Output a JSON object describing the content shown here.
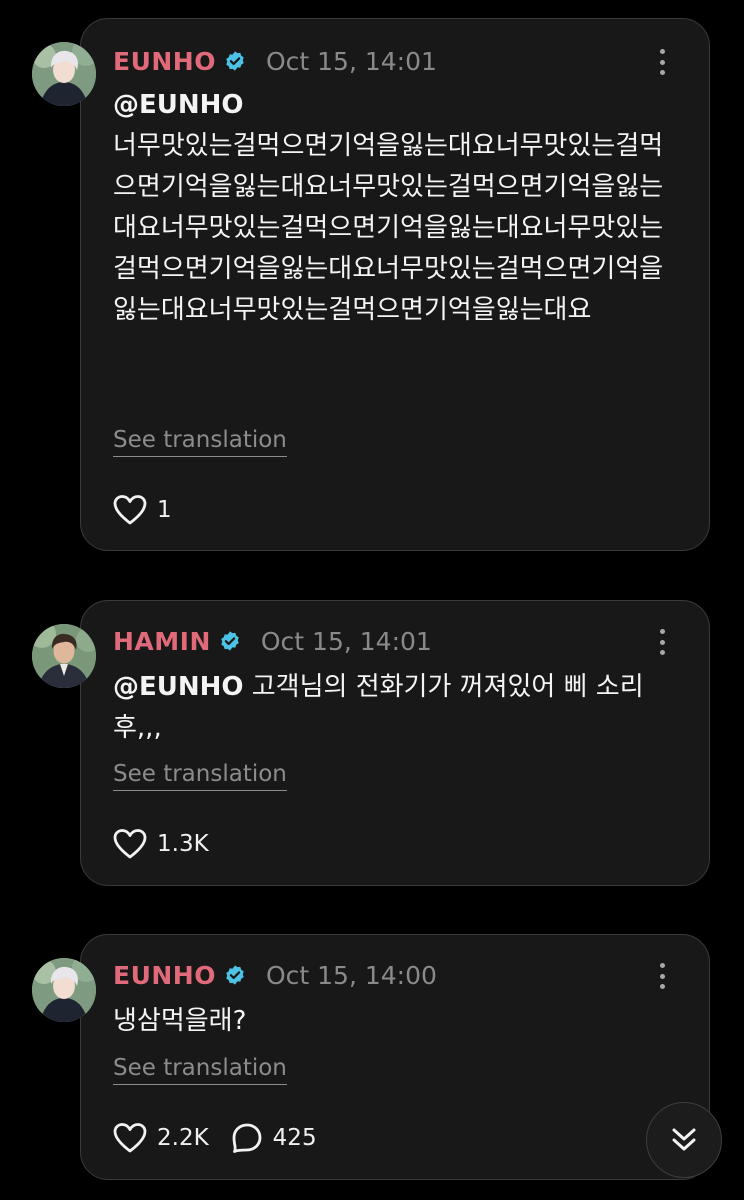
{
  "posts": [
    {
      "author": "EUNHO",
      "verified": true,
      "timestamp": "Oct 15, 14:01",
      "mention": "@EUNHO",
      "text": "너무맛있는걸먹으면기억을잃는대요너무맛있는걸먹으면기억을잃는대요너무맛있는걸먹으면기억을잃는대요너무맛있는걸먹으면기억을잃는대요너무맛있는걸먹으면기억을잃는대요너무맛있는걸먹으면기억을잃는대요너무맛있는걸먹으면기억을잃는대요",
      "translate_label": "See translation",
      "likes": "1"
    },
    {
      "author": "HAMIN",
      "verified": true,
      "timestamp": "Oct 15, 14:01",
      "mention": "@EUNHO",
      "text": " 고객님의 전화기가 꺼져있어 삐 소리 후,,,",
      "translate_label": "See translation",
      "likes": "1.3K"
    },
    {
      "author": "EUNHO",
      "verified": true,
      "timestamp": "Oct 15, 14:00",
      "text": "냉삼먹을래?",
      "translate_label": "See translation",
      "likes": "2.2K",
      "replies": "425"
    }
  ],
  "icons": {
    "verified": "verified-badge-icon",
    "more": "more-vertical-icon",
    "like": "heart-icon",
    "reply": "reply-bubble-icon",
    "scroll_down": "double-chevron-down-icon"
  },
  "colors": {
    "background": "#000000",
    "card": "#181818",
    "name": "#e06a7a",
    "verified": "#4cc3e6",
    "muted": "#8a8a8a"
  }
}
